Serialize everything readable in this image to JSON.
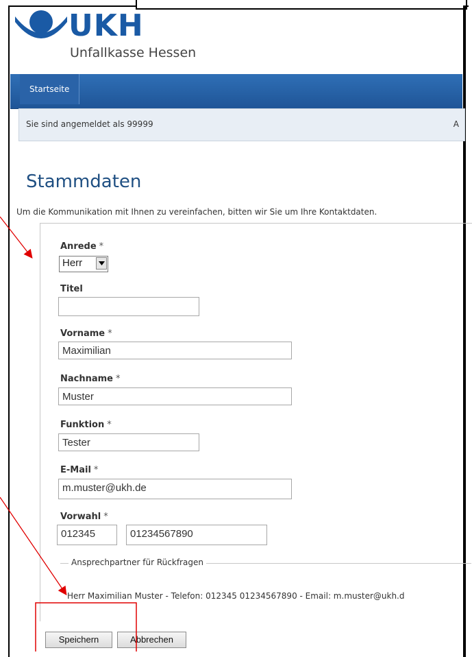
{
  "brand": {
    "name": "UKH",
    "subtitle": "Unfallkasse Hessen",
    "color": "#1a5aa5"
  },
  "nav": {
    "tabs": [
      {
        "label": "Startseite"
      }
    ]
  },
  "status": {
    "logged_in_text": "Sie sind angemeldet als 99999",
    "right_text": "A"
  },
  "page": {
    "title": "Stammdaten",
    "intro": "Um die Kommunikation mit Ihnen zu vereinfachen, bitten wir Sie um Ihre Kontaktdaten."
  },
  "form": {
    "required_mark": "*",
    "anrede": {
      "label": "Anrede",
      "value": "Herr"
    },
    "titel": {
      "label": "Titel",
      "value": ""
    },
    "vorname": {
      "label": "Vorname",
      "value": "Maximilian"
    },
    "nachname": {
      "label": "Nachname",
      "value": "Muster"
    },
    "funktion": {
      "label": "Funktion",
      "value": "Tester"
    },
    "email": {
      "label": "E-Mail",
      "value": "m.muster@ukh.de"
    },
    "vorwahl": {
      "label": "Vorwahl",
      "value": "012345",
      "number": "01234567890"
    },
    "contact_legend": "Ansprechpartner für Rückfragen",
    "contact_summary": "Herr Maximilian Muster - Telefon: 012345 01234567890 - Email: m.muster@ukh.d",
    "save_label": "Speichern",
    "cancel_label": "Abbrechen"
  },
  "annotation_color": "#e00000"
}
